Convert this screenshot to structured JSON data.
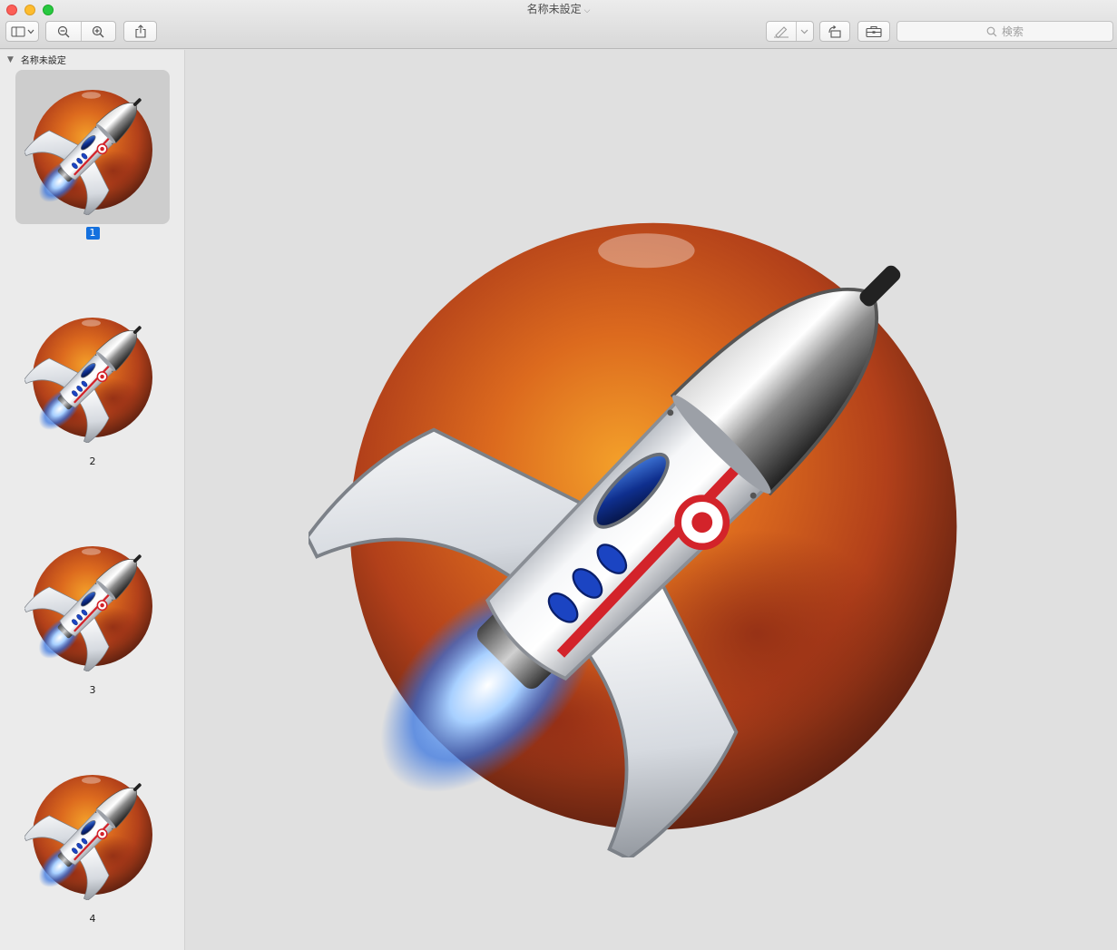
{
  "window": {
    "title": "名称未設定"
  },
  "toolbar": {
    "search_placeholder": "検索"
  },
  "sidebar": {
    "document_name": "名称未設定",
    "pages": [
      {
        "number": "1",
        "selected": true
      },
      {
        "number": "2",
        "selected": false
      },
      {
        "number": "3",
        "selected": false
      },
      {
        "number": "4",
        "selected": false
      }
    ]
  },
  "colors": {
    "selection_blue": "#1470de",
    "planet": "#c2481c",
    "flame": "#3f8cff"
  }
}
